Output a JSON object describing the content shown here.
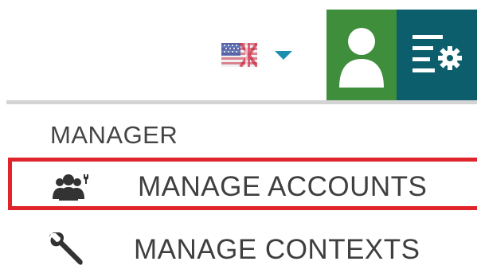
{
  "header": {
    "language": {
      "icon": "uk-flag-icon",
      "caret_icon": "caret-down-icon"
    },
    "user_button": {
      "icon": "user-icon"
    },
    "settings_menu_button": {
      "icon": "menu-settings-icon"
    }
  },
  "menu": {
    "section_title": "MANAGER",
    "items": [
      {
        "label": "MANAGE ACCOUNTS",
        "icon": "accounts-icon",
        "active": true
      },
      {
        "label": "MANAGE CONTEXTS",
        "icon": "wrench-icon",
        "active": false
      }
    ]
  },
  "colors": {
    "user_button_bg": "#3f8e3b",
    "menu_button_bg": "#0c5e6c",
    "highlight_border": "#e0242c",
    "caret": "#1b8fb0"
  }
}
